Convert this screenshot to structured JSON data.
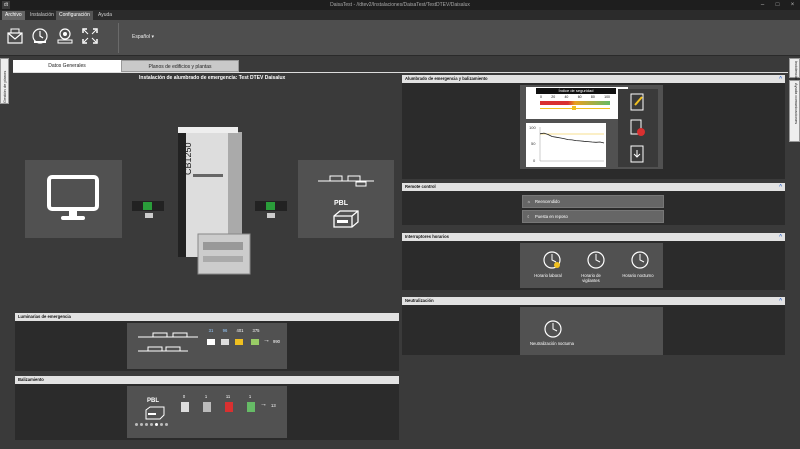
{
  "window": {
    "title": "DaisaTest - //dtev2/Instalaciones/DaisaTest/TestDTEV/Daisalux",
    "logo": "dt",
    "minimize": "–",
    "maximize": "□",
    "close": "×"
  },
  "menus": [
    "Archivo",
    "Instalación",
    "Configuración",
    "Ayuda"
  ],
  "ribbon": {
    "icons": [
      "envelope-icon",
      "clock-icon",
      "settings-search-icon",
      "fullscreen-icon"
    ],
    "language": "Español"
  },
  "sidebar_left": "Gestión de planos",
  "sidebar_right": [
    "Incidencias",
    "Ayuda comunicaciones"
  ],
  "tabs": [
    "Datos Generales",
    "Planos de edificios y plantas"
  ],
  "heading": "Instalación de alumbrado de emergencia: Test DTEV Daisalux",
  "central": {
    "model": "CB1250",
    "pbl": "PBL"
  },
  "luminarias": {
    "title": "Luminarias de emergencia",
    "counts": [
      "31",
      "96",
      "401",
      "375",
      "990"
    ]
  },
  "balizamiento": {
    "title": "Balizamiento",
    "pbl": "PBL",
    "counts": [
      "0",
      "1",
      "11",
      "1",
      "13"
    ],
    "page_dots": 7,
    "active_dot": 5
  },
  "alumbrado": {
    "title": "Alumbrado de emergencia y balizamiento",
    "gauge_title": "Índice de seguridad",
    "gauge_ticks": [
      "0",
      "20",
      "40",
      "60",
      "80",
      "100"
    ],
    "gauge_value": 48,
    "chart_ticks": [
      "100",
      "50",
      "0"
    ],
    "chart_series": [
      80,
      82,
      78,
      72,
      70,
      68,
      66,
      63,
      62,
      60,
      59,
      58,
      57,
      56,
      55,
      56,
      53
    ]
  },
  "remote": {
    "title": "Remote control",
    "buttons": [
      "Reencendido",
      "Puesta en reposo"
    ]
  },
  "interruptores": {
    "title": "Interruptores horarios",
    "items": [
      "Horario laboral",
      "Horario de vigilantes",
      "Horario nocturno"
    ]
  },
  "neutralizacion": {
    "title": "Neutralización",
    "item": "Neutralización nocturna"
  },
  "collapse_icon": "^",
  "colors": {
    "accent": "#f0c020",
    "green": "#2a9d3a",
    "red": "#d93030",
    "bg": "#3a3a3a"
  }
}
